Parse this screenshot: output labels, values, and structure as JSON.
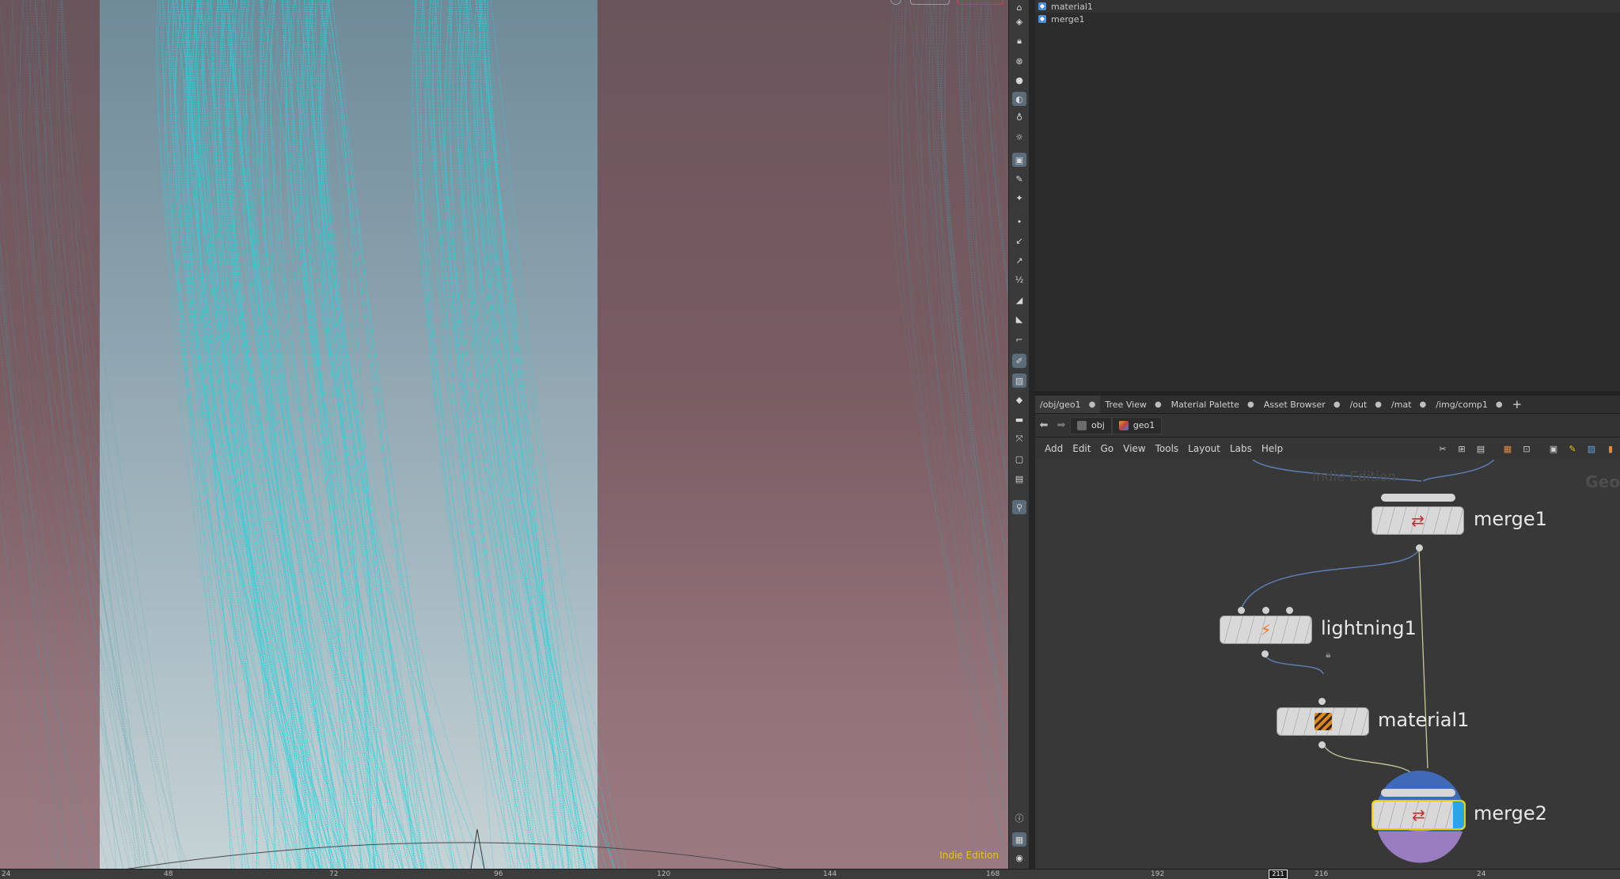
{
  "viewport": {
    "indie_badge": "Indie Edition"
  },
  "tree": {
    "items": [
      {
        "label": "material1"
      },
      {
        "label": "merge1"
      }
    ]
  },
  "tabs": [
    {
      "label": "/obj/geo1",
      "active": true
    },
    {
      "label": "Tree View"
    },
    {
      "label": "Material Palette"
    },
    {
      "label": "Asset Browser"
    },
    {
      "label": "/out"
    },
    {
      "label": "/mat"
    },
    {
      "label": "/img/comp1"
    }
  ],
  "tab_add_label": "+",
  "path": {
    "crumbs": [
      {
        "label": "obj"
      },
      {
        "label": "geo1"
      }
    ]
  },
  "menu": [
    "Add",
    "Edit",
    "Go",
    "View",
    "Tools",
    "Layout",
    "Labs",
    "Help"
  ],
  "network": {
    "watermark": "Indie Edition",
    "context_label": "Geo",
    "nodes": [
      {
        "name": "merge1",
        "icon": "merge-icon"
      },
      {
        "name": "lightning1",
        "icon": "lightning-icon"
      },
      {
        "name": "material1",
        "icon": "material-icon"
      },
      {
        "name": "merge2",
        "icon": "merge-icon",
        "display_flag": true
      }
    ]
  },
  "timeline": {
    "ticks": [
      "24",
      "48",
      "72",
      "96",
      "120",
      "144",
      "168",
      "192",
      "216",
      "24"
    ],
    "current_frame": "211"
  },
  "colors": {
    "curves": "#1fd6e0",
    "accent_blue": "#4e8ed4",
    "indie_yellow": "#e6c21a"
  }
}
